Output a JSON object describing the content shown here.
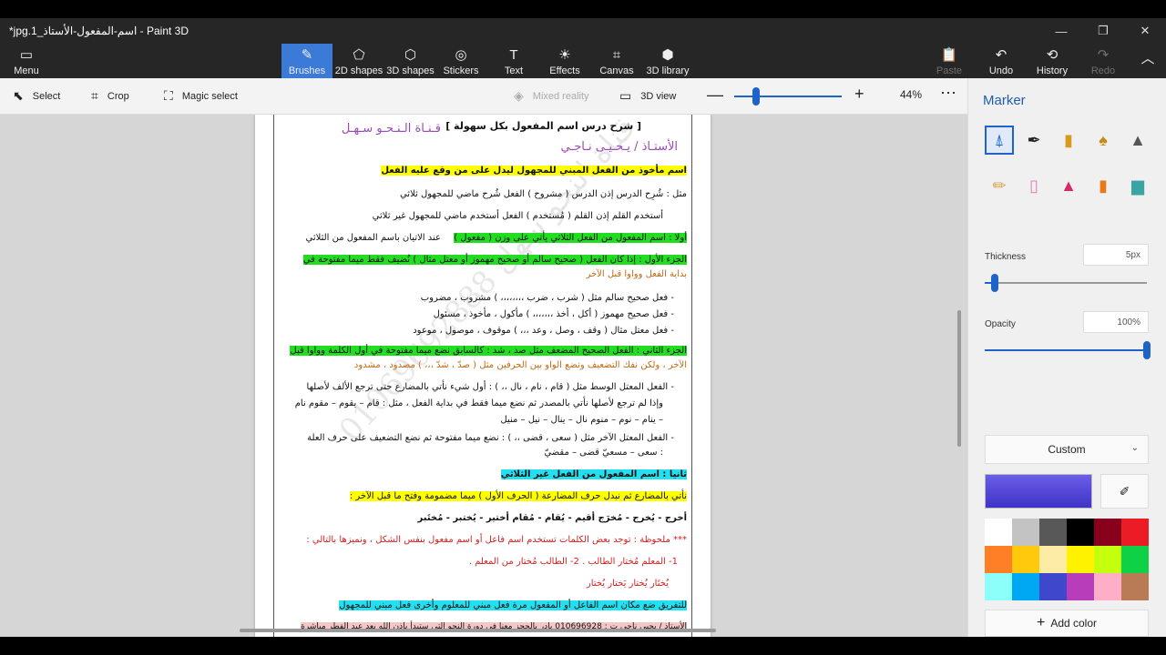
{
  "window": {
    "title": "*jpg.1_اسم-المفعول-الأستاذ - Paint 3D",
    "minimize_icon": "minimize-icon",
    "maximize_icon": "restore-icon",
    "close_icon": "close-icon"
  },
  "ribbon": {
    "menu_label": "Menu",
    "tabs": [
      {
        "label": "Brushes",
        "icon": "brush-icon",
        "active": true
      },
      {
        "label": "2D shapes",
        "icon": "2d-shapes-icon"
      },
      {
        "label": "3D shapes",
        "icon": "3d-shapes-icon"
      },
      {
        "label": "Stickers",
        "icon": "stickers-icon"
      },
      {
        "label": "Text",
        "icon": "text-icon"
      },
      {
        "label": "Effects",
        "icon": "effects-icon"
      },
      {
        "label": "Canvas",
        "icon": "canvas-icon"
      },
      {
        "label": "3D library",
        "icon": "3d-library-icon"
      }
    ],
    "paste_label": "Paste",
    "undo_label": "Undo",
    "history_label": "History",
    "redo_label": "Redo"
  },
  "toolbar": {
    "select_label": "Select",
    "crop_label": "Crop",
    "magic_select_label": "Magic select",
    "mixed_reality_label": "Mixed reality",
    "view_3d_label": "3D view",
    "zoom_percent": "44%",
    "zoom_fraction": 0.2
  },
  "document": {
    "header_title": "[ شرح درس اسم المفعول بكل سهولة ]",
    "header_channel": "قـنـاة الـنـحـو سـهـل",
    "header_teacher": "الأستـاذ / يـحـيـى نـاجـي",
    "definition": "اسم مأخوذ من الفعل المبني للمجهول ليدل على من وقع عليه الفعل",
    "ex1": "مثل : شُرِح الدرس       إذن الدرس ( مشروح )     الفعل شُرح ماضي للمجهول ثلاثي",
    "ex2": "أستخدم القلم         إذن القلم   ( مُستخدم )     الفعل أستخدم ماضي للمجهول غير ثلاثي",
    "first_heading": "أولا : اسم المفعول من الفعل الثلاثي يأتي على وزن ( مفعول )",
    "first_note": "عند الاتيان باسم المفعول من الثلاثي",
    "part1_a": "الجزء الأول : إذا كان الفعل ( صحيح سالم أو صحيح مهموز أو معتل مثال ) نُضيف فقط ميما مفتوحة في",
    "part1_b": "بداية الفعل وواوا قبل الآخر",
    "part1_list1": "- فعل صحيح سالم مثل ( شرب ، ضرب ،،،،،،،، )    مشروب  ،  مضروب",
    "part1_list2": "- فعل صحيح مهموز  ( أكل ، أخذ ،،،،،،، ) مأكول  ، مأخوذ ،  مسئول",
    "part1_list3": "- فعل معتل مثال    ( وقف ، وصل ، وعد ،،، ) موقوف ، موصول ، موعود",
    "part2_a": "الجزء الثاني : الفعل الصحيح المضعف مثل صد ، شد : كالسابق نضع ميما مفتوحة في أول الكلمة وواوا قبل",
    "part2_b": "الآخر ، ولكن نفك التضعيف ونضع الواو بين الحرفين     مثل ( صدّ ، شدّ ،،، )  مصدود ، مشدود",
    "hollow_1": "- الفعل المعتل الوسط مثل ( قام ، نام ، نال ،، ) : أول شيء نأتي بالمضارع حتى ترجع الألف لأصلها",
    "hollow_2": "وإذا لم ترجع لأصلها نأتي بالمصدر ثم نضع ميما فقط في بداية الفعل ، مثل : قام – يقوم – مقوم    نام",
    "hollow_3": "– ينام – نوم – منوم       نال – ينال – نيل – منيل",
    "defective_1": "- الفعل المعتل الآخر مثل ( سعى ، قضى ،، ) : نضع ميما مفتوحة ثم نضع التضعيف على حرف العلة",
    "defective_2": ":        سعى – مسعيّ        قضى – مقضيّ",
    "second_heading": "ثانيا : اسم المفعول من الفعل غير الثلاثي",
    "second_rule": "نأتي بالمضارع ثم نبدل حرف المضارعة ( الحرف الأول ) ميما مضمومة وفتح ما قبل الآخر :",
    "second_examples": "أخرج  - يُخرج  - مُخرَج           أقيم  - يُقام  - مُقام         أختير - يُختبر - مُختَبر",
    "note": "*** ملحوظة : توجد بعض الكلمات تستخدم اسم فاعل أو اسم مفعول بنفس الشكل ، ونميزها بالتالي :",
    "note_ex": "1- المعلم مُختار الطالب .       2- الطالب مُختار من المعلم .",
    "note_forms": "يُختَار  يُختار           يَختار  يُختار",
    "distinguish": "للتفريق ضع مكان اسم الفاعل أو المفعول مرة فعل مبني للمعلوم وأخرى فعل مبني للمجهول",
    "footer": "الأستاذ / يحيى ناجي    ت : 010696928 بادر بالحجز معنا في دورة النحو التي ستبدأ بإذن الله بعد عيد الفطر مباشرة",
    "watermark": "قناة النحو سهل 01069692888"
  },
  "panel": {
    "title": "Marker",
    "brushes": [
      "marker-icon",
      "calligraphy-pen-icon",
      "oil-brush-icon",
      "watercolor-icon",
      "pixel-pen-icon",
      "pencil-icon",
      "eraser-icon",
      "crayon-icon",
      "spray-can-icon",
      "fill-icon"
    ],
    "thickness_label": "Thickness",
    "thickness_value": "5px",
    "thickness_fraction": 0.06,
    "opacity_label": "Opacity",
    "opacity_value": "100%",
    "opacity_fraction": 1.0,
    "color_mode": "Custom",
    "current_color": "#4a3fd6",
    "swatches": [
      "#ffffff",
      "#c3c3c3",
      "#585858",
      "#000000",
      "#88001b",
      "#ec1c24",
      "#ff7f27",
      "#ffc90e",
      "#fdeca6",
      "#fff200",
      "#c4ff0e",
      "#0ed145",
      "#8cfffb",
      "#00a8f3",
      "#3f48cc",
      "#b83dba",
      "#ffaec8",
      "#b97a56"
    ],
    "add_color_label": "Add color"
  }
}
